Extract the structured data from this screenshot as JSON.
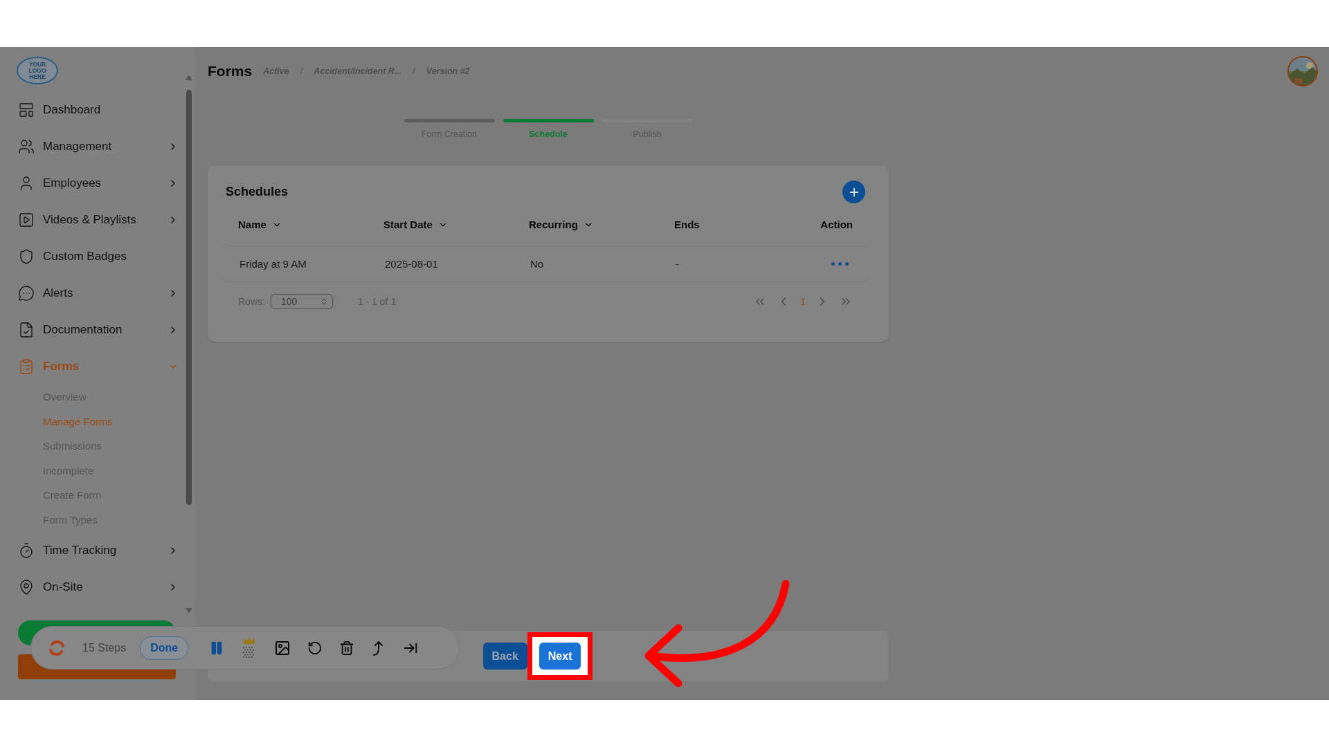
{
  "header": {
    "logo_text": "YOUR LOGO HERE",
    "title": "Forms",
    "breadcrumbs": [
      "Active",
      "Accident/Incident R...",
      "Version #2"
    ],
    "separator": "/"
  },
  "sidebar": {
    "items": [
      {
        "label": "Dashboard",
        "selected": false
      },
      {
        "label": "Management",
        "selected": false,
        "expanded": false
      },
      {
        "label": "Employees",
        "selected": false,
        "expanded": false
      },
      {
        "label": "Videos & Playlists",
        "selected": false,
        "expanded": false
      },
      {
        "label": "Custom Badges",
        "selected": false
      },
      {
        "label": "Alerts",
        "selected": false,
        "expanded": false
      },
      {
        "label": "Documentation",
        "selected": false,
        "expanded": false
      },
      {
        "label": "Forms",
        "selected": true,
        "expanded": true,
        "children": [
          {
            "label": "Overview",
            "selected": false
          },
          {
            "label": "Manage Forms",
            "selected": true
          },
          {
            "label": "Submissions",
            "selected": false
          },
          {
            "label": "Incomplete",
            "selected": false
          },
          {
            "label": "Create Form",
            "selected": false
          },
          {
            "label": "Form Types",
            "selected": false
          }
        ]
      },
      {
        "label": "Time Tracking",
        "selected": false,
        "expanded": false
      },
      {
        "label": "On-Site",
        "selected": false,
        "expanded": false
      }
    ]
  },
  "stepper": [
    {
      "label": "Form Creation",
      "selected": false,
      "completed": true
    },
    {
      "label": "Schedule",
      "selected": true,
      "completed": false
    },
    {
      "label": "Publish",
      "selected": false,
      "completed": false
    }
  ],
  "schedules": {
    "title": "Schedules",
    "columns": [
      {
        "label": "Name",
        "sortable": true
      },
      {
        "label": "Start Date",
        "sortable": true
      },
      {
        "label": "Recurring",
        "sortable": true
      },
      {
        "label": "Ends",
        "sortable": false
      },
      {
        "label": "Action",
        "sortable": false
      }
    ],
    "rows": [
      {
        "name": "Friday at 9 AM",
        "start_date": "2025-08-01",
        "recurring": "No",
        "ends": "-"
      }
    ],
    "pagination": {
      "rows_label": "Rows:",
      "rows_value": "100",
      "range": "1 - 1 of 1",
      "page": "1"
    }
  },
  "footer_buttons": [
    {
      "label": "Back",
      "highlighted": false
    },
    {
      "label": "Next",
      "highlighted": true
    }
  ],
  "recorder": {
    "steps": "15 Steps",
    "done": "Done"
  }
}
